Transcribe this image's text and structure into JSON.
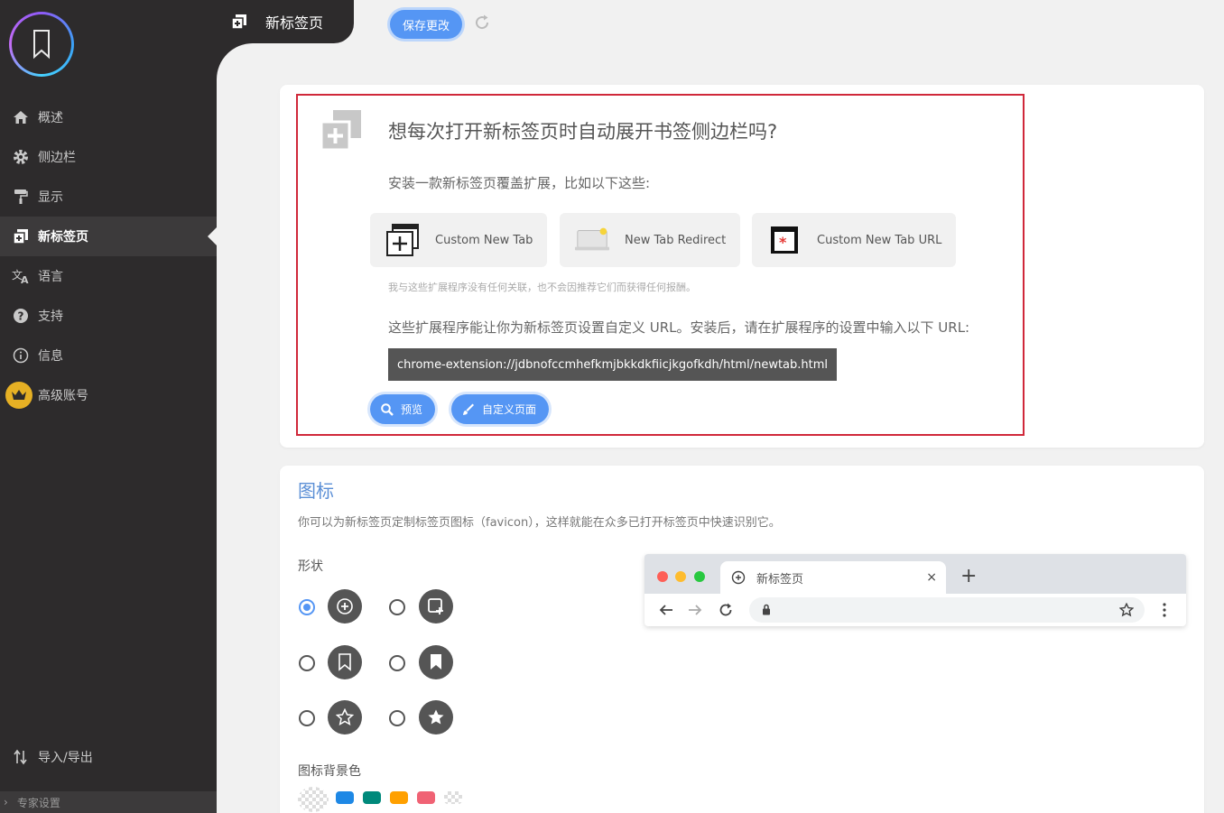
{
  "header": {
    "title": "新标签页",
    "save_label": "保存更改"
  },
  "sidebar": {
    "items": [
      {
        "label": "概述",
        "icon": "home-icon"
      },
      {
        "label": "侧边栏",
        "icon": "gear-icon"
      },
      {
        "label": "显示",
        "icon": "paint-roller-icon"
      },
      {
        "label": "新标签页",
        "icon": "new-tab-icon"
      },
      {
        "label": "语言",
        "icon": "translate-icon"
      },
      {
        "label": "支持",
        "icon": "help-icon"
      },
      {
        "label": "信息",
        "icon": "info-icon"
      },
      {
        "label": "高级账号",
        "icon": "crown-icon"
      }
    ],
    "import_export": "导入/导出",
    "expert": "专家设置"
  },
  "newtab_card": {
    "title": "想每次打开新标签页时自动展开书签侧边栏吗?",
    "subtitle": "安装一款新标签页覆盖扩展，比如以下这些:",
    "extensions": [
      "Custom New Tab",
      "New Tab Redirect",
      "Custom New Tab URL"
    ],
    "disclaimer": "我与这些扩展程序没有任何关联，也不会因推荐它们而获得任何报酬。",
    "description": "这些扩展程序能让你为新标签页设置自定义 URL。安装后，请在扩展程序的设置中输入以下 URL:",
    "url": "chrome-extension://jdbnofccmhefkmjbkkdkfiicjkgofkdh/html/newtab.html",
    "preview_label": "预览",
    "customize_label": "自定义页面"
  },
  "icon_card": {
    "title": "图标",
    "description": "你可以为新标签页定制标签页图标（favicon），这样就能在众多已打开标签页中快速识别它。",
    "shape_label": "形状",
    "bg_label": "图标背景色",
    "swatches": [
      "transparent",
      "#1e88e5",
      "#00897b",
      "#ffa000",
      "#f06274",
      "transparent"
    ],
    "browser_tab_label": "新标签页"
  }
}
